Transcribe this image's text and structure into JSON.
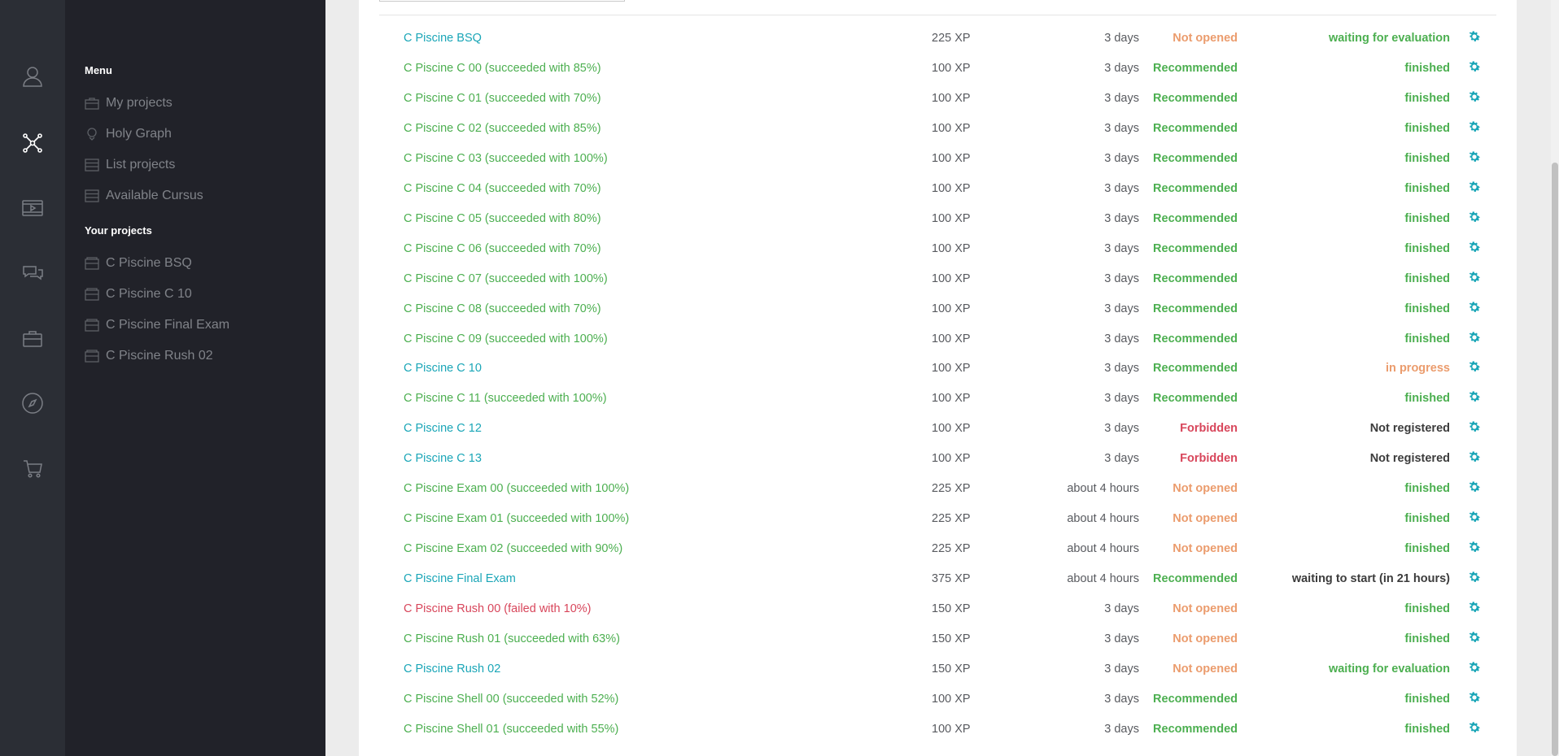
{
  "colors": {
    "link": "#1aa6b7",
    "success": "#4caf50",
    "fail": "#d8465b",
    "warn": "#eb9c6d",
    "neutral": "#3c3c3c",
    "gear": "#1aa6b7"
  },
  "rail_icons": [
    "profile-icon",
    "graph-icon",
    "video-icon",
    "chat-icon",
    "briefcase-icon",
    "compass-icon",
    "cart-icon"
  ],
  "sidebar": {
    "menu_title": "Menu",
    "menu_items": [
      {
        "label": "My projects",
        "icon": "folder-icon"
      },
      {
        "label": "Holy Graph",
        "icon": "holy-graph-icon"
      },
      {
        "label": "List projects",
        "icon": "list-icon"
      },
      {
        "label": "Available Cursus",
        "icon": "list-icon"
      }
    ],
    "projects_title": "Your projects",
    "project_items": [
      {
        "label": "C Piscine BSQ",
        "icon": "project-icon"
      },
      {
        "label": "C Piscine C 10",
        "icon": "project-icon"
      },
      {
        "label": "C Piscine Final Exam",
        "icon": "project-icon"
      },
      {
        "label": "C Piscine Rush 02",
        "icon": "project-icon"
      }
    ]
  },
  "table": {
    "rows": [
      {
        "name": "C Piscine BSQ",
        "name_color": "link",
        "duration": "3 days",
        "xp": "225 XP",
        "recommendation": "Not opened",
        "rec_color": "warn",
        "status": "waiting for evaluation",
        "status_color": "success"
      },
      {
        "name": "C Piscine C 00 (succeeded with 85%)",
        "name_color": "success",
        "duration": "3 days",
        "xp": "100 XP",
        "recommendation": "Recommended",
        "rec_color": "success",
        "status": "finished",
        "status_color": "success"
      },
      {
        "name": "C Piscine C 01 (succeeded with 70%)",
        "name_color": "success",
        "duration": "3 days",
        "xp": "100 XP",
        "recommendation": "Recommended",
        "rec_color": "success",
        "status": "finished",
        "status_color": "success"
      },
      {
        "name": "C Piscine C 02 (succeeded with 85%)",
        "name_color": "success",
        "duration": "3 days",
        "xp": "100 XP",
        "recommendation": "Recommended",
        "rec_color": "success",
        "status": "finished",
        "status_color": "success"
      },
      {
        "name": "C Piscine C 03 (succeeded with 100%)",
        "name_color": "success",
        "duration": "3 days",
        "xp": "100 XP",
        "recommendation": "Recommended",
        "rec_color": "success",
        "status": "finished",
        "status_color": "success"
      },
      {
        "name": "C Piscine C 04 (succeeded with 70%)",
        "name_color": "success",
        "duration": "3 days",
        "xp": "100 XP",
        "recommendation": "Recommended",
        "rec_color": "success",
        "status": "finished",
        "status_color": "success"
      },
      {
        "name": "C Piscine C 05 (succeeded with 80%)",
        "name_color": "success",
        "duration": "3 days",
        "xp": "100 XP",
        "recommendation": "Recommended",
        "rec_color": "success",
        "status": "finished",
        "status_color": "success"
      },
      {
        "name": "C Piscine C 06 (succeeded with 70%)",
        "name_color": "success",
        "duration": "3 days",
        "xp": "100 XP",
        "recommendation": "Recommended",
        "rec_color": "success",
        "status": "finished",
        "status_color": "success"
      },
      {
        "name": "C Piscine C 07 (succeeded with 100%)",
        "name_color": "success",
        "duration": "3 days",
        "xp": "100 XP",
        "recommendation": "Recommended",
        "rec_color": "success",
        "status": "finished",
        "status_color": "success"
      },
      {
        "name": "C Piscine C 08 (succeeded with 70%)",
        "name_color": "success",
        "duration": "3 days",
        "xp": "100 XP",
        "recommendation": "Recommended",
        "rec_color": "success",
        "status": "finished",
        "status_color": "success"
      },
      {
        "name": "C Piscine C 09 (succeeded with 100%)",
        "name_color": "success",
        "duration": "3 days",
        "xp": "100 XP",
        "recommendation": "Recommended",
        "rec_color": "success",
        "status": "finished",
        "status_color": "success"
      },
      {
        "name": "C Piscine C 10",
        "name_color": "link",
        "duration": "3 days",
        "xp": "100 XP",
        "recommendation": "Recommended",
        "rec_color": "success",
        "status": "in progress",
        "status_color": "warn"
      },
      {
        "name": "C Piscine C 11 (succeeded with 100%)",
        "name_color": "success",
        "duration": "3 days",
        "xp": "100 XP",
        "recommendation": "Recommended",
        "rec_color": "success",
        "status": "finished",
        "status_color": "success"
      },
      {
        "name": "C Piscine C 12",
        "name_color": "link",
        "duration": "3 days",
        "xp": "100 XP",
        "recommendation": "Forbidden",
        "rec_color": "fail",
        "status": "Not registered",
        "status_color": "neutral"
      },
      {
        "name": "C Piscine C 13",
        "name_color": "link",
        "duration": "3 days",
        "xp": "100 XP",
        "recommendation": "Forbidden",
        "rec_color": "fail",
        "status": "Not registered",
        "status_color": "neutral"
      },
      {
        "name": "C Piscine Exam 00 (succeeded with 100%)",
        "name_color": "success",
        "duration": "about 4 hours",
        "xp": "225 XP",
        "recommendation": "Not opened",
        "rec_color": "warn",
        "status": "finished",
        "status_color": "success"
      },
      {
        "name": "C Piscine Exam 01 (succeeded with 100%)",
        "name_color": "success",
        "duration": "about 4 hours",
        "xp": "225 XP",
        "recommendation": "Not opened",
        "rec_color": "warn",
        "status": "finished",
        "status_color": "success"
      },
      {
        "name": "C Piscine Exam 02 (succeeded with 90%)",
        "name_color": "success",
        "duration": "about 4 hours",
        "xp": "225 XP",
        "recommendation": "Not opened",
        "rec_color": "warn",
        "status": "finished",
        "status_color": "success"
      },
      {
        "name": "C Piscine Final Exam",
        "name_color": "link",
        "duration": "about 4 hours",
        "xp": "375 XP",
        "recommendation": "Recommended",
        "rec_color": "success",
        "status": "waiting to start (in 21 hours)",
        "status_color": "neutral"
      },
      {
        "name": "C Piscine Rush 00 (failed with 10%)",
        "name_color": "fail",
        "duration": "3 days",
        "xp": "150 XP",
        "recommendation": "Not opened",
        "rec_color": "warn",
        "status": "finished",
        "status_color": "success"
      },
      {
        "name": "C Piscine Rush 01 (succeeded with 63%)",
        "name_color": "success",
        "duration": "3 days",
        "xp": "150 XP",
        "recommendation": "Not opened",
        "rec_color": "warn",
        "status": "finished",
        "status_color": "success"
      },
      {
        "name": "C Piscine Rush 02",
        "name_color": "link",
        "duration": "3 days",
        "xp": "150 XP",
        "recommendation": "Not opened",
        "rec_color": "warn",
        "status": "waiting for evaluation",
        "status_color": "success"
      },
      {
        "name": "C Piscine Shell 00 (succeeded with 52%)",
        "name_color": "success",
        "duration": "3 days",
        "xp": "100 XP",
        "recommendation": "Recommended",
        "rec_color": "success",
        "status": "finished",
        "status_color": "success"
      },
      {
        "name": "C Piscine Shell 01 (succeeded with 55%)",
        "name_color": "success",
        "duration": "3 days",
        "xp": "100 XP",
        "recommendation": "Recommended",
        "rec_color": "success",
        "status": "finished",
        "status_color": "success"
      }
    ]
  }
}
